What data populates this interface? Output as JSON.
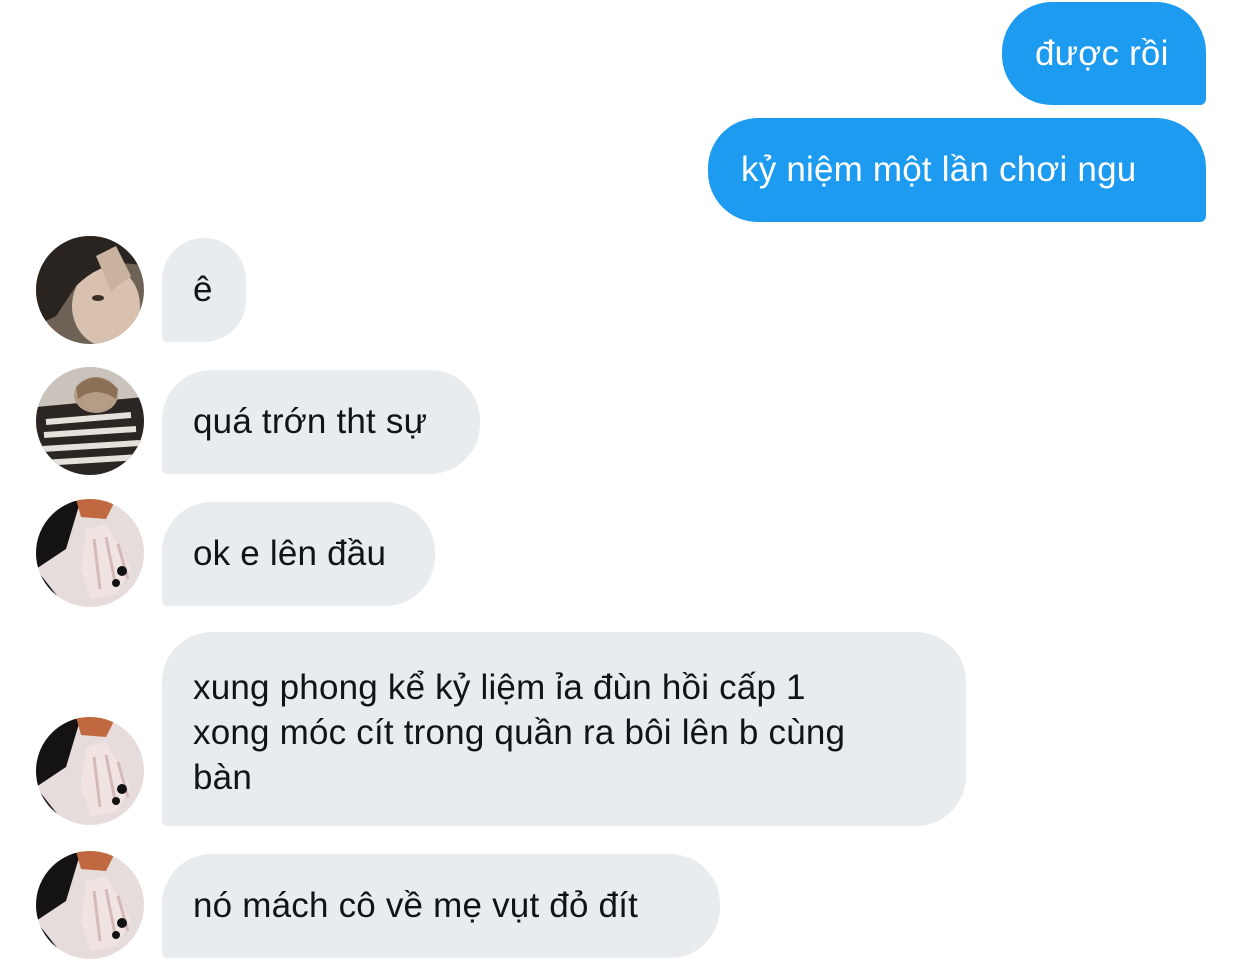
{
  "messages": [
    {
      "sender": "me",
      "text": "được rồi"
    },
    {
      "sender": "me",
      "text": "kỷ niệm một lần chơi ngu"
    },
    {
      "sender": "user-1",
      "text": "ê"
    },
    {
      "sender": "user-2",
      "text": "quá trớn tht sự"
    },
    {
      "sender": "user-3",
      "text": "ok e lên đầu"
    },
    {
      "sender": "user-3",
      "lines": [
        "xung phong kể kỷ liệm ỉa đùn hồi cấp 1",
        "xong móc cít trong quần ra bôi lên b cùng",
        "bàn"
      ]
    },
    {
      "sender": "user-3",
      "text": "nó mách cô về mẹ vụt đỏ đít"
    }
  ],
  "colors": {
    "outgoing_bubble": "#1d9bf0",
    "outgoing_text": "#ffffff",
    "incoming_bubble": "#e8ecef",
    "incoming_text": "#0f1419",
    "background": "#ffffff"
  }
}
